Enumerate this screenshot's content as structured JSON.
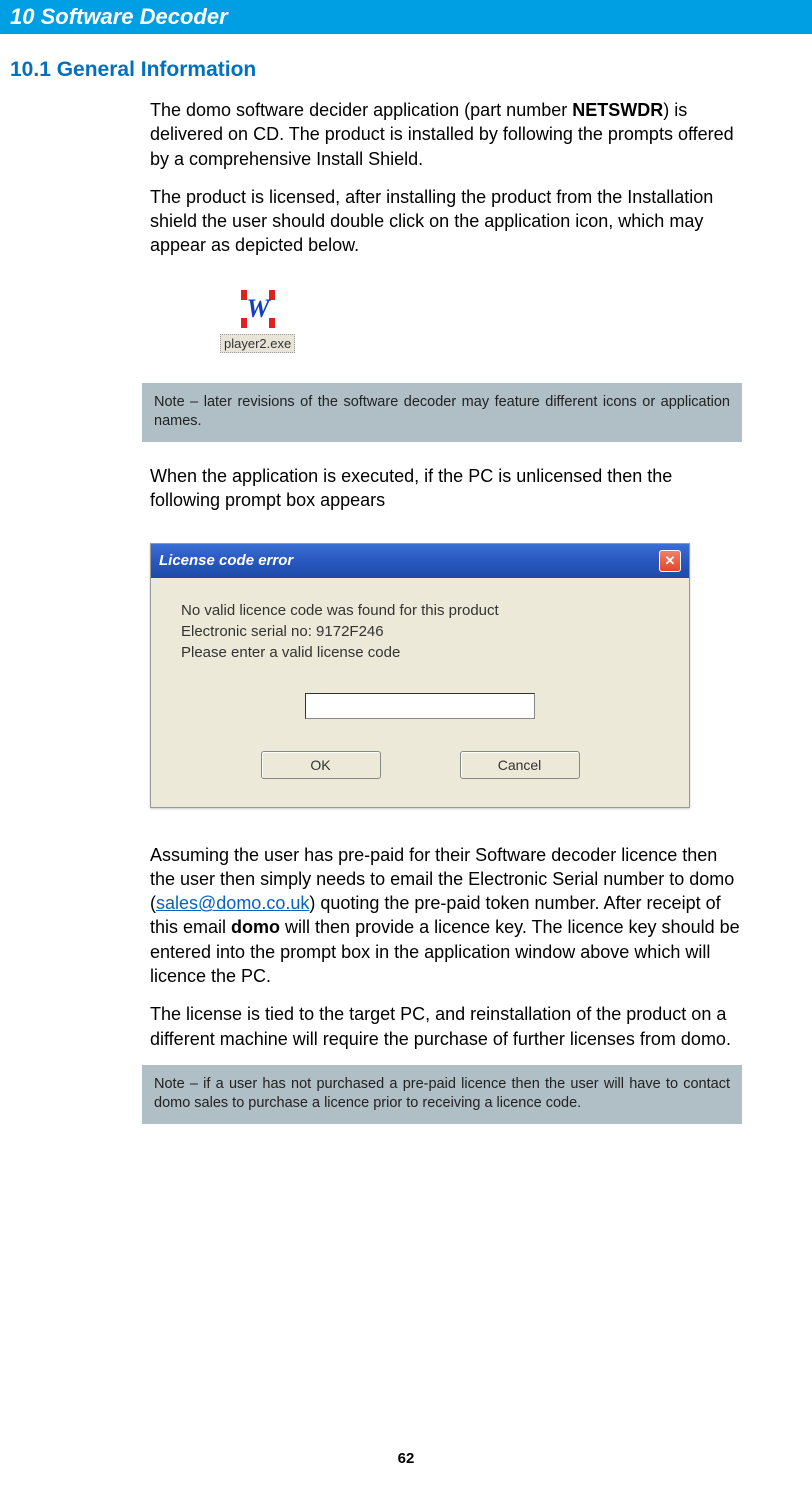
{
  "chapter": {
    "number": "10",
    "title": "Software Decoder"
  },
  "section": {
    "number": "10.1",
    "title": "General Information"
  },
  "paragraphs": {
    "p1_a": "The domo software decider application (part number ",
    "p1_bold": "NETSWDR",
    "p1_b": ") is delivered on CD. The product is installed by following the prompts offered by a comprehensive Install Shield.",
    "p2": "The product is licensed, after installing the product from the Installation shield the user should double click on the application icon, which may appear as depicted below.",
    "p3": "When the application is executed, if the PC is unlicensed then the following prompt box appears",
    "p4_a": "Assuming the user has pre-paid for their Software decoder licence then the user then simply needs to email the Electronic Serial number to domo (",
    "p4_email": "sales@domo.co.uk",
    "p4_b": ") quoting the pre-paid token number. After receipt of this email ",
    "p4_bold": "domo",
    "p4_c": " will then provide a licence key. The licence key should be entered into the prompt box in the application window above which will licence the PC.",
    "p5": "The license is tied to the target PC, and reinstallation of the product on a different machine will require the purchase of further licenses from domo."
  },
  "app_icon": {
    "label": "player2.exe",
    "letter": "W"
  },
  "notes": {
    "n1": "Note – later revisions of the software decoder may feature different icons or application names.",
    "n2": "Note – if a user has not purchased a pre-paid licence then the user will have to contact domo sales to purchase a licence prior to receiving a licence code."
  },
  "dialog": {
    "title": "License code error",
    "line1": "No valid licence code was found for this product",
    "line2": "Electronic serial no: 9172F246",
    "line3": "Please enter a valid license code",
    "ok": "OK",
    "cancel": "Cancel",
    "close_symbol": "✕"
  },
  "page_number": "62"
}
